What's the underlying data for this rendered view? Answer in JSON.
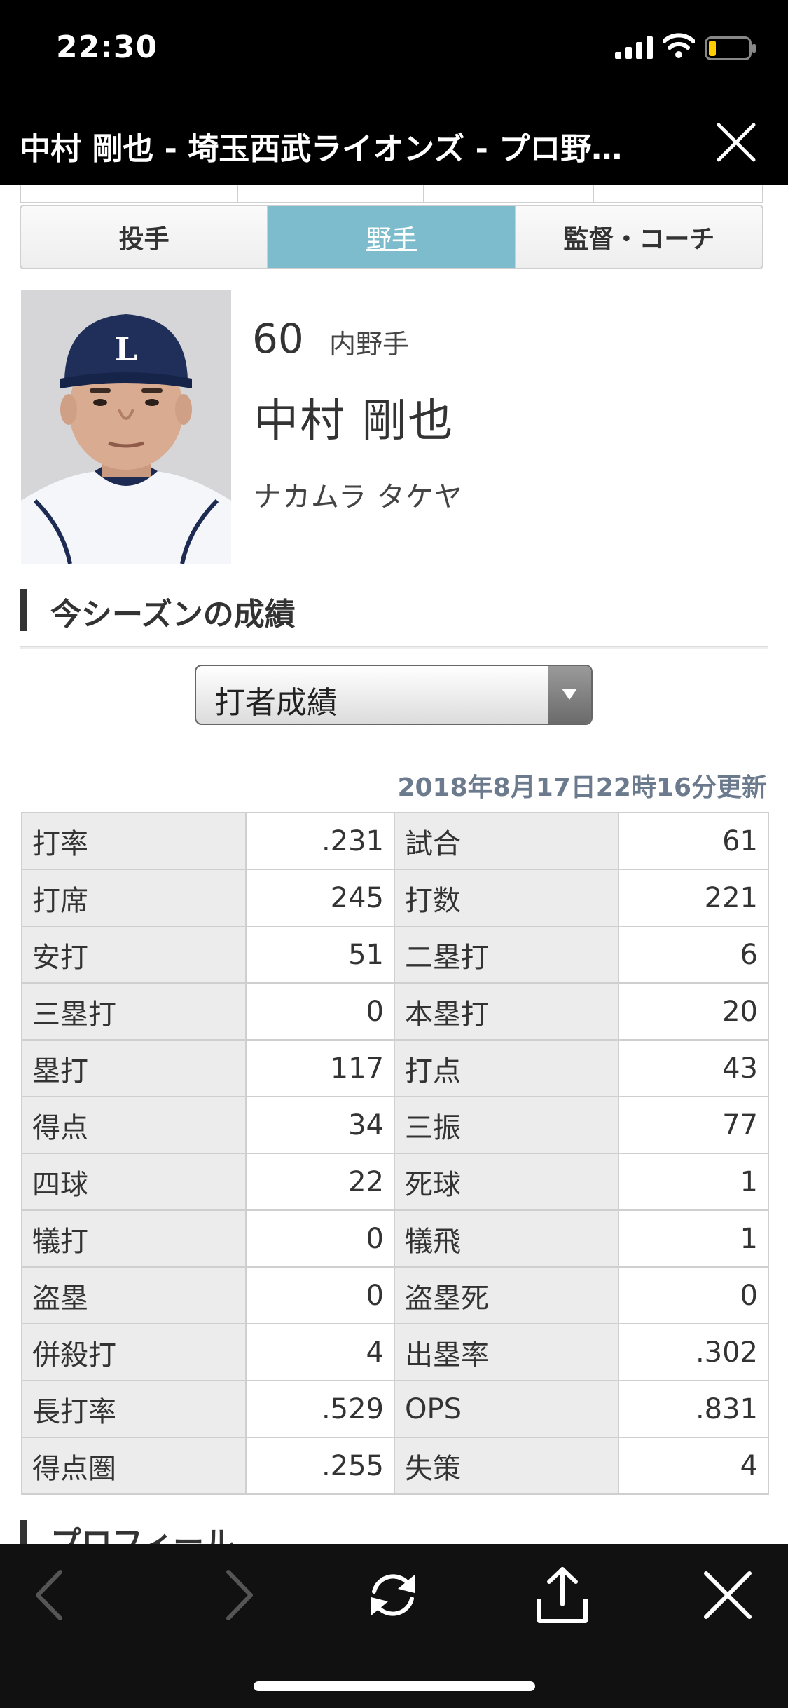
{
  "status_bar": {
    "time": "22:30"
  },
  "title_bar": {
    "title": "中村 剛也 - 埼玉西武ライオンズ - プロ野…"
  },
  "tabs": [
    {
      "label": "投手",
      "active": false
    },
    {
      "label": "野手",
      "active": true
    },
    {
      "label": "監督・コーチ",
      "active": false
    }
  ],
  "player": {
    "number": "60",
    "position": "内野手",
    "name": "中村 剛也",
    "kana": "ナカムラ タケヤ"
  },
  "season_section": {
    "heading": "今シーズンの成績",
    "select_value": "打者成績",
    "updated": "2018年8月17日22時16分更新"
  },
  "stats": [
    [
      "打率",
      ".231",
      "試合",
      "61"
    ],
    [
      "打席",
      "245",
      "打数",
      "221"
    ],
    [
      "安打",
      "51",
      "二塁打",
      "6"
    ],
    [
      "三塁打",
      "0",
      "本塁打",
      "20"
    ],
    [
      "塁打",
      "117",
      "打点",
      "43"
    ],
    [
      "得点",
      "34",
      "三振",
      "77"
    ],
    [
      "四球",
      "22",
      "死球",
      "1"
    ],
    [
      "犠打",
      "0",
      "犠飛",
      "1"
    ],
    [
      "盗塁",
      "0",
      "盗塁死",
      "0"
    ],
    [
      "併殺打",
      "4",
      "出塁率",
      ".302"
    ],
    [
      "長打率",
      ".529",
      "OPS",
      ".831"
    ],
    [
      "得点圏",
      ".255",
      "失策",
      "4"
    ]
  ],
  "profile_section": {
    "heading": "プロフィール"
  },
  "colors": {
    "active_tab": "#7dbccd",
    "updated_text": "#6b7a8c",
    "table_label_bg": "#ececec"
  }
}
